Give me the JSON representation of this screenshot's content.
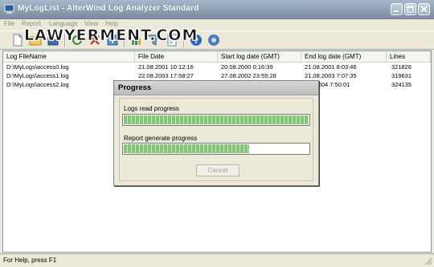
{
  "window": {
    "title": "MyLogList - AlterWind Log Analyzer Standard"
  },
  "menu": {
    "items": [
      "File",
      "Report",
      "Language",
      "View",
      "Help"
    ]
  },
  "watermark": {
    "text": "LAWYERMENT.COM"
  },
  "toolbar": {
    "icons": [
      "new-icon",
      "open-icon",
      "save-icon",
      "refresh-icon",
      "delete-icon",
      "add-icon",
      "chart-icon",
      "filter-icon",
      "report-icon",
      "help-icon",
      "about-icon"
    ]
  },
  "list": {
    "columns": [
      "Log FileName",
      "File Date",
      "Start log date (GMT)",
      "End log date (GMT)",
      "Lines"
    ],
    "rows": [
      [
        "D:\\MyLogs\\access0.log",
        "21.08.2001 10:12:16",
        "20.08.2000 0:16:39",
        "21.08.2001 8:03:46",
        "321826"
      ],
      [
        "D:\\MyLogs\\access1.log",
        "22.08.2003 17:58:27",
        "27.08.2002 23:55:28",
        "21.08.2003 7:07:35",
        "319631"
      ],
      [
        "D:\\MyLogs\\access2.log",
        "",
        "",
        "...9.2004 7:50:01",
        "324135"
      ]
    ]
  },
  "dialog": {
    "title": "Progress",
    "logs_label": "Logs read progress",
    "logs_progress": 1.0,
    "report_label": "Report generate progress",
    "report_progress": 0.68,
    "cancel_label": "Cancel"
  },
  "status": {
    "text": "For Help, press F1"
  },
  "colors": {
    "progress_fill": "#86c478",
    "title_bar": "#8c9db2"
  }
}
